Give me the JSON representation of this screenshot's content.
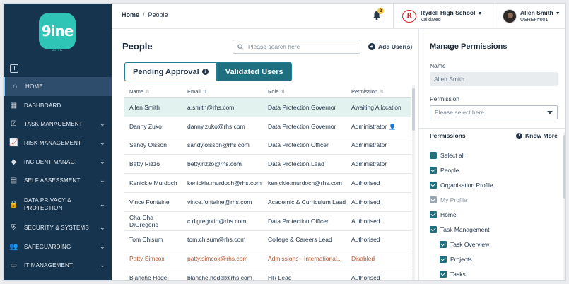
{
  "brand": {
    "logo_text": "9ine",
    "logo_sub": "9ine"
  },
  "colors": {
    "sidebar_bg": "#17344f",
    "accent_teal": "#1e6f80",
    "logo": "#2ec4b6",
    "disabled_text": "#b4562e"
  },
  "sidebar": {
    "items": [
      {
        "label": "HOME",
        "icon": "home-icon",
        "chevron": false,
        "active": true
      },
      {
        "label": "DASHBOARD",
        "icon": "dashboard-icon",
        "chevron": false
      },
      {
        "label": "TASK MANAGEMENT",
        "icon": "task-icon",
        "chevron": true
      },
      {
        "label": "RISK MANAGEMENT",
        "icon": "chart-icon",
        "chevron": true
      },
      {
        "label": "INCIDENT MANAG.",
        "icon": "tag-icon",
        "chevron": true
      },
      {
        "label": "SELF ASSESSMENT",
        "icon": "assessment-icon",
        "chevron": true
      },
      {
        "label": "DATA PRIVACY & PROTECTION",
        "icon": "lock-icon",
        "chevron": true
      },
      {
        "label": "SECURITY & SYSTEMS",
        "icon": "shield-icon",
        "chevron": true
      },
      {
        "label": "SAFEGUARDING",
        "icon": "people-icon",
        "chevron": true
      },
      {
        "label": "IT MANAGEMENT",
        "icon": "monitor-icon",
        "chevron": true
      }
    ]
  },
  "header": {
    "breadcrumb_home": "Home",
    "breadcrumb_sep": "/",
    "breadcrumb_current": "People",
    "notification_count": "2",
    "school_logo_letter": "R",
    "school_name": "Rydell High School",
    "school_status": "Validated",
    "user_name": "Allen Smith",
    "user_ref": "USREF#001"
  },
  "main": {
    "title": "People",
    "search_placeholder": "Please search here",
    "add_user_label": "Add User(s)",
    "tabs": [
      {
        "label": "Pending Approval",
        "active": false
      },
      {
        "label": "Validated Users",
        "active": true
      }
    ],
    "columns": [
      "Name",
      "Email",
      "Role",
      "Permission"
    ],
    "rows": [
      {
        "name": "Allen Smith",
        "email": "a.smith@rhs.com",
        "role": "Data Protection Governor",
        "permission": "Awaiting Allocation",
        "selected": true
      },
      {
        "name": "Danny Zuko",
        "email": "danny.zuko@rhs.com",
        "role": "Data Protection Governor",
        "permission": "Administrator",
        "admin_icon": true
      },
      {
        "name": "Sandy Olsson",
        "email": "sandy.olsson@rhs.com",
        "role": "Data Protection Officer",
        "permission": "Administrator"
      },
      {
        "name": "Betty Rizzo",
        "email": "betty.rizzo@rhs.com",
        "role": "Data Protection Lead",
        "permission": "Administrator"
      },
      {
        "name": "Kenickie Murdoch",
        "email": "kenickie.murdoch@rhs.com",
        "role": "kenickie.murdoch@rhs.com",
        "permission": "Authorised"
      },
      {
        "name": "Vince Fontaine",
        "email": "vince.fontaine@rhs.com",
        "role": "Academic & Curriculum Lead",
        "permission": "Authorised"
      },
      {
        "name": "Cha-Cha DiGregorio",
        "email": "c.digregorio@rhs.com",
        "role": "Data Protection Officer",
        "permission": "Authorised"
      },
      {
        "name": "Tom Chisum",
        "email": "tom.chisum@rhs.com",
        "role": "College & Careers Lead",
        "permission": "Authorised"
      },
      {
        "name": "Patty Simcox",
        "email": "patty.simcox@rhs.com",
        "role": "Admissions - International...",
        "permission": "Disabled",
        "disabled": true
      },
      {
        "name": "Blanche Hodel",
        "email": "blanche.hodel@rhs.com",
        "role": "HR Lead",
        "permission": "Authorised"
      }
    ]
  },
  "panel": {
    "title": "Manage Permissions",
    "name_label": "Name",
    "name_value": "Allen Smith",
    "permission_label": "Permission",
    "permission_placeholder": "Please select here",
    "permissions_heading": "Permissions",
    "know_more": "Know More",
    "items": [
      {
        "label": "Select all",
        "state": "indeterminate",
        "level": 0
      },
      {
        "label": "People",
        "state": "checked",
        "level": 0
      },
      {
        "label": "Organisation Profile",
        "state": "checked",
        "level": 0
      },
      {
        "label": "My Profile",
        "state": "checked-disabled",
        "level": 0
      },
      {
        "label": "Home",
        "state": "checked",
        "level": 0
      },
      {
        "label": "Task Management",
        "state": "checked",
        "level": 0
      },
      {
        "label": "Task Overview",
        "state": "checked",
        "level": 1
      },
      {
        "label": "Projects",
        "state": "checked",
        "level": 1
      },
      {
        "label": "Tasks",
        "state": "checked",
        "level": 1
      }
    ]
  }
}
